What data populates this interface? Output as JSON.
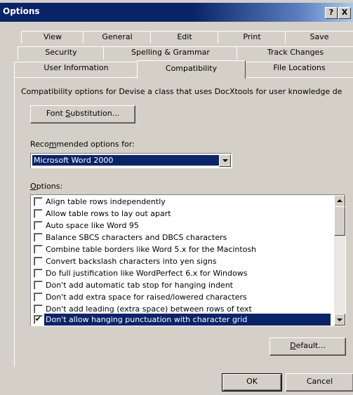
{
  "window": {
    "title": "Options",
    "help_glyph": "?",
    "close_glyph": "X"
  },
  "tabs": {
    "row1": [
      "View",
      "General",
      "Edit",
      "Print",
      "Save"
    ],
    "row2": [
      "Security",
      "Spelling & Grammar",
      "Track Changes"
    ],
    "row3": [
      "User Information",
      "Compatibility",
      "File Locations"
    ],
    "active": "Compatibility"
  },
  "panel": {
    "description": "Compatibility options for Devise a class that uses DocXtools for user knowledge de",
    "font_sub_pre": "Font ",
    "font_sub_ul": "S",
    "font_sub_post": "ubstitution...",
    "rec_label_pre": "Reco",
    "rec_label_ul": "m",
    "rec_label_post": "mended options for:",
    "rec_value": "Microsoft Word 2000",
    "options_label_ul": "O",
    "options_label_post": "ptions:",
    "options": [
      {
        "label": "Align table rows independently",
        "checked": false
      },
      {
        "label": "Allow table rows to lay out apart",
        "checked": false
      },
      {
        "label": "Auto space like Word 95",
        "checked": false
      },
      {
        "label": "Balance SBCS characters and DBCS characters",
        "checked": false
      },
      {
        "label": "Combine table borders like Word 5.x for the Macintosh",
        "checked": false
      },
      {
        "label": "Convert backslash characters into yen signs",
        "checked": false
      },
      {
        "label": "Do full justification like WordPerfect 6.x for Windows",
        "checked": false
      },
      {
        "label": "Don't add automatic tab stop for hanging indent",
        "checked": false
      },
      {
        "label": "Don't add extra space for raised/lowered characters",
        "checked": false
      },
      {
        "label": "Don't add leading (extra space) between rows of text",
        "checked": false
      },
      {
        "label": "Don't allow hanging punctuation with character grid",
        "checked": true,
        "selected": true
      }
    ],
    "check_glyph": "✔",
    "default_ul": "D",
    "default_post": "efault..."
  },
  "footer": {
    "ok": "OK",
    "cancel": "Cancel"
  },
  "colors": {
    "face": "#d4d0c8",
    "title_dark": "#0a246a",
    "title_light": "#a6caf0",
    "selection": "#0a246a"
  }
}
